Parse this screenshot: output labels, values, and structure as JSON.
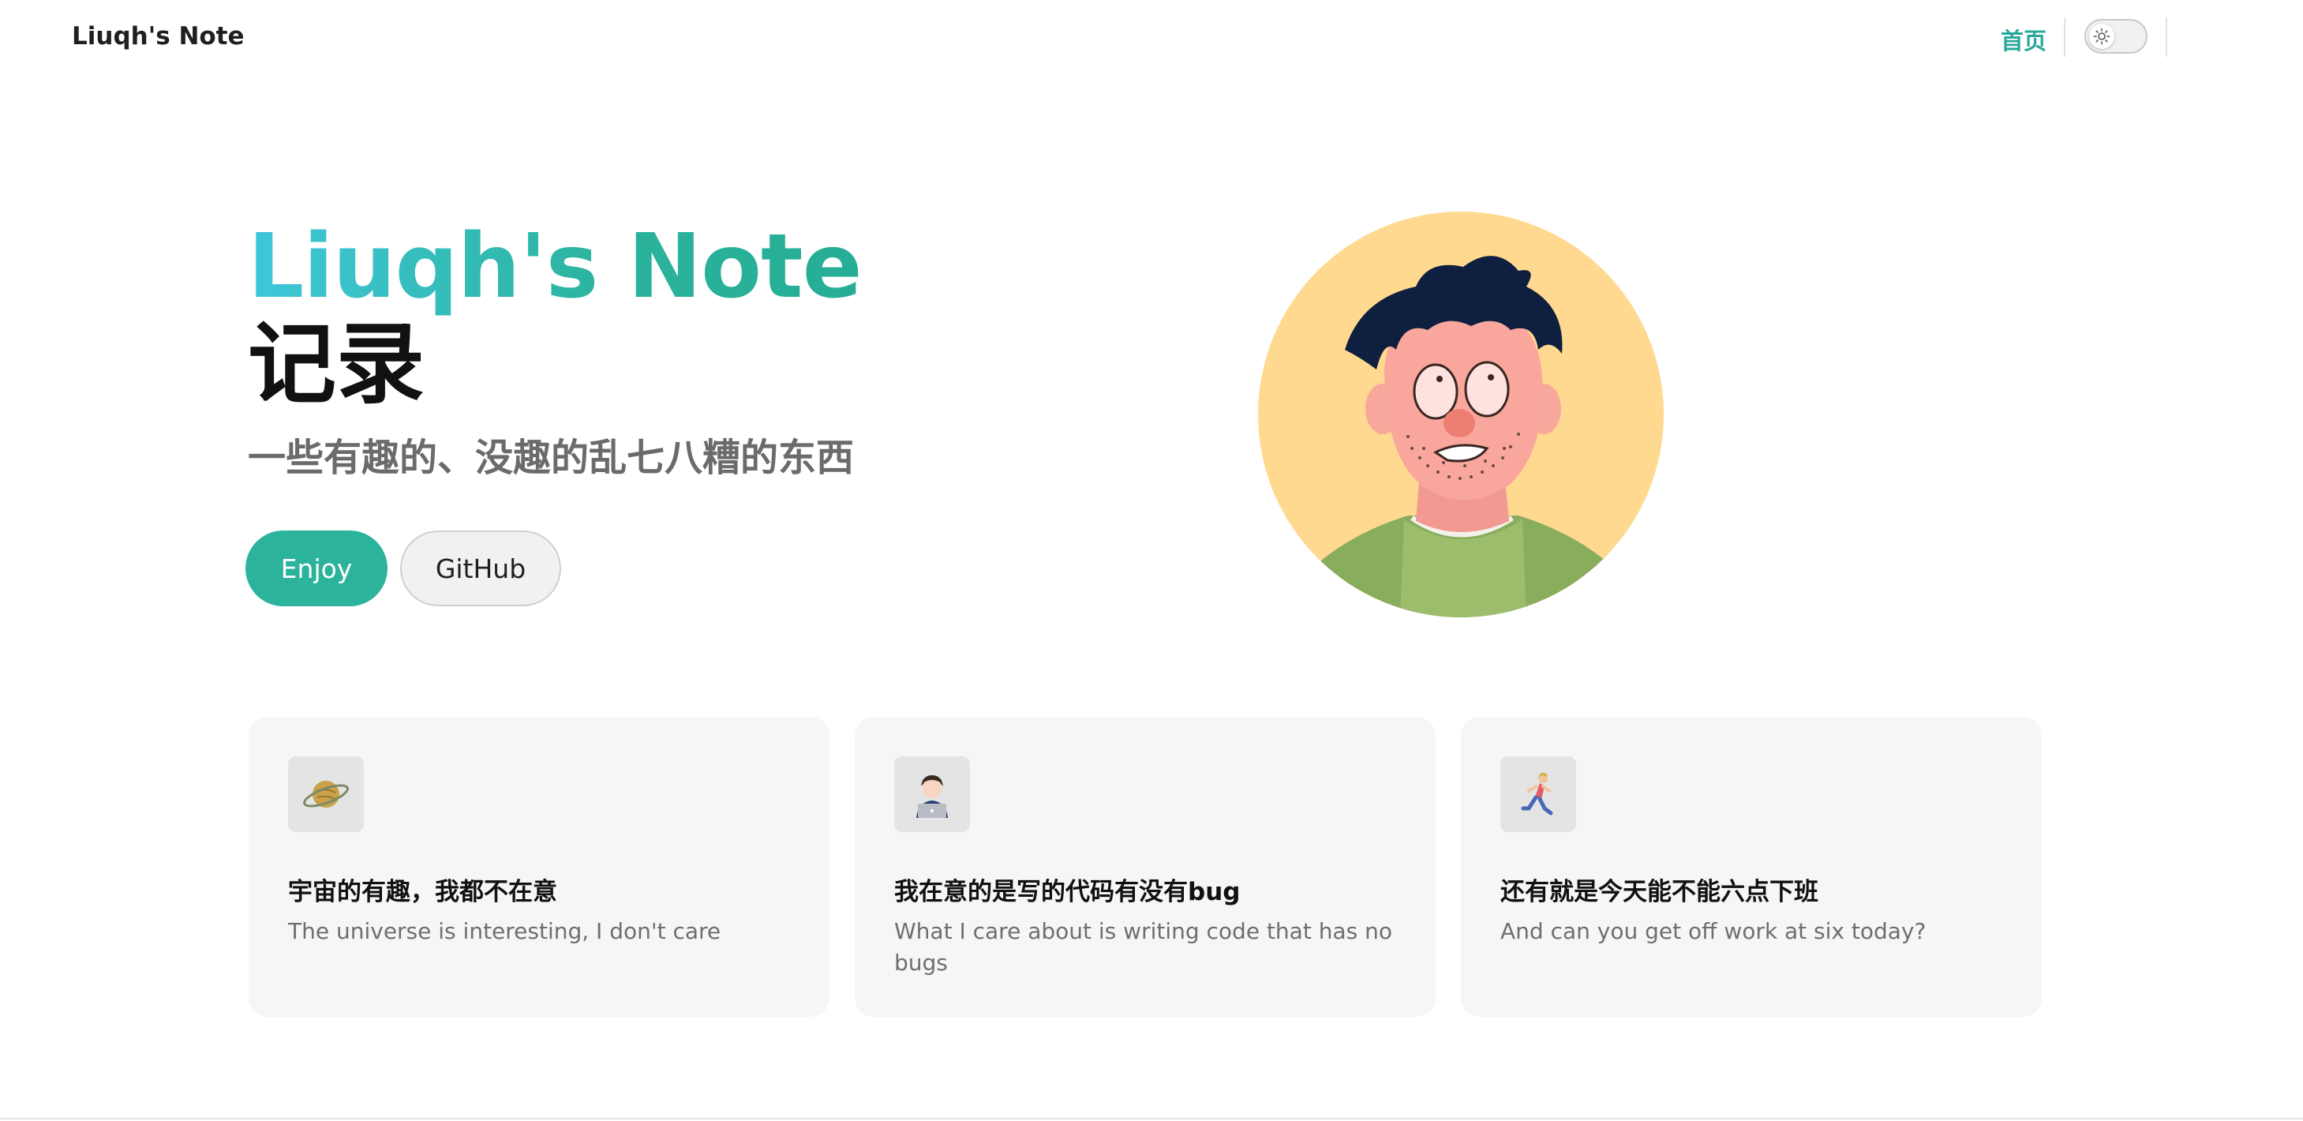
{
  "nav": {
    "brand": "Liuqh's Note",
    "home_link": "首页",
    "theme_toggle_icon": "sun-icon"
  },
  "hero": {
    "title": "Liuqh's Note",
    "subtitle": "记录",
    "tagline": "一些有趣的、没趣的乱七八糟的东西",
    "primary_button": "Enjoy",
    "secondary_button": "GitHub",
    "avatar_icon": "avatar-illustration"
  },
  "features": [
    {
      "icon": "planet-icon",
      "title": "宇宙的有趣，我都不在意",
      "desc": "The universe is interesting, I don't care"
    },
    {
      "icon": "developer-icon",
      "title": "我在意的是写的代码有没有bug",
      "desc": "What I care about is writing code that has no bugs"
    },
    {
      "icon": "runner-icon",
      "title": "还有就是今天能不能六点下班",
      "desc": "And can you get off work at six today?"
    }
  ],
  "colors": {
    "accent": "#2bb39c",
    "gradient_start": "#3ec7d9",
    "avatar_bg": "#ffd990"
  }
}
